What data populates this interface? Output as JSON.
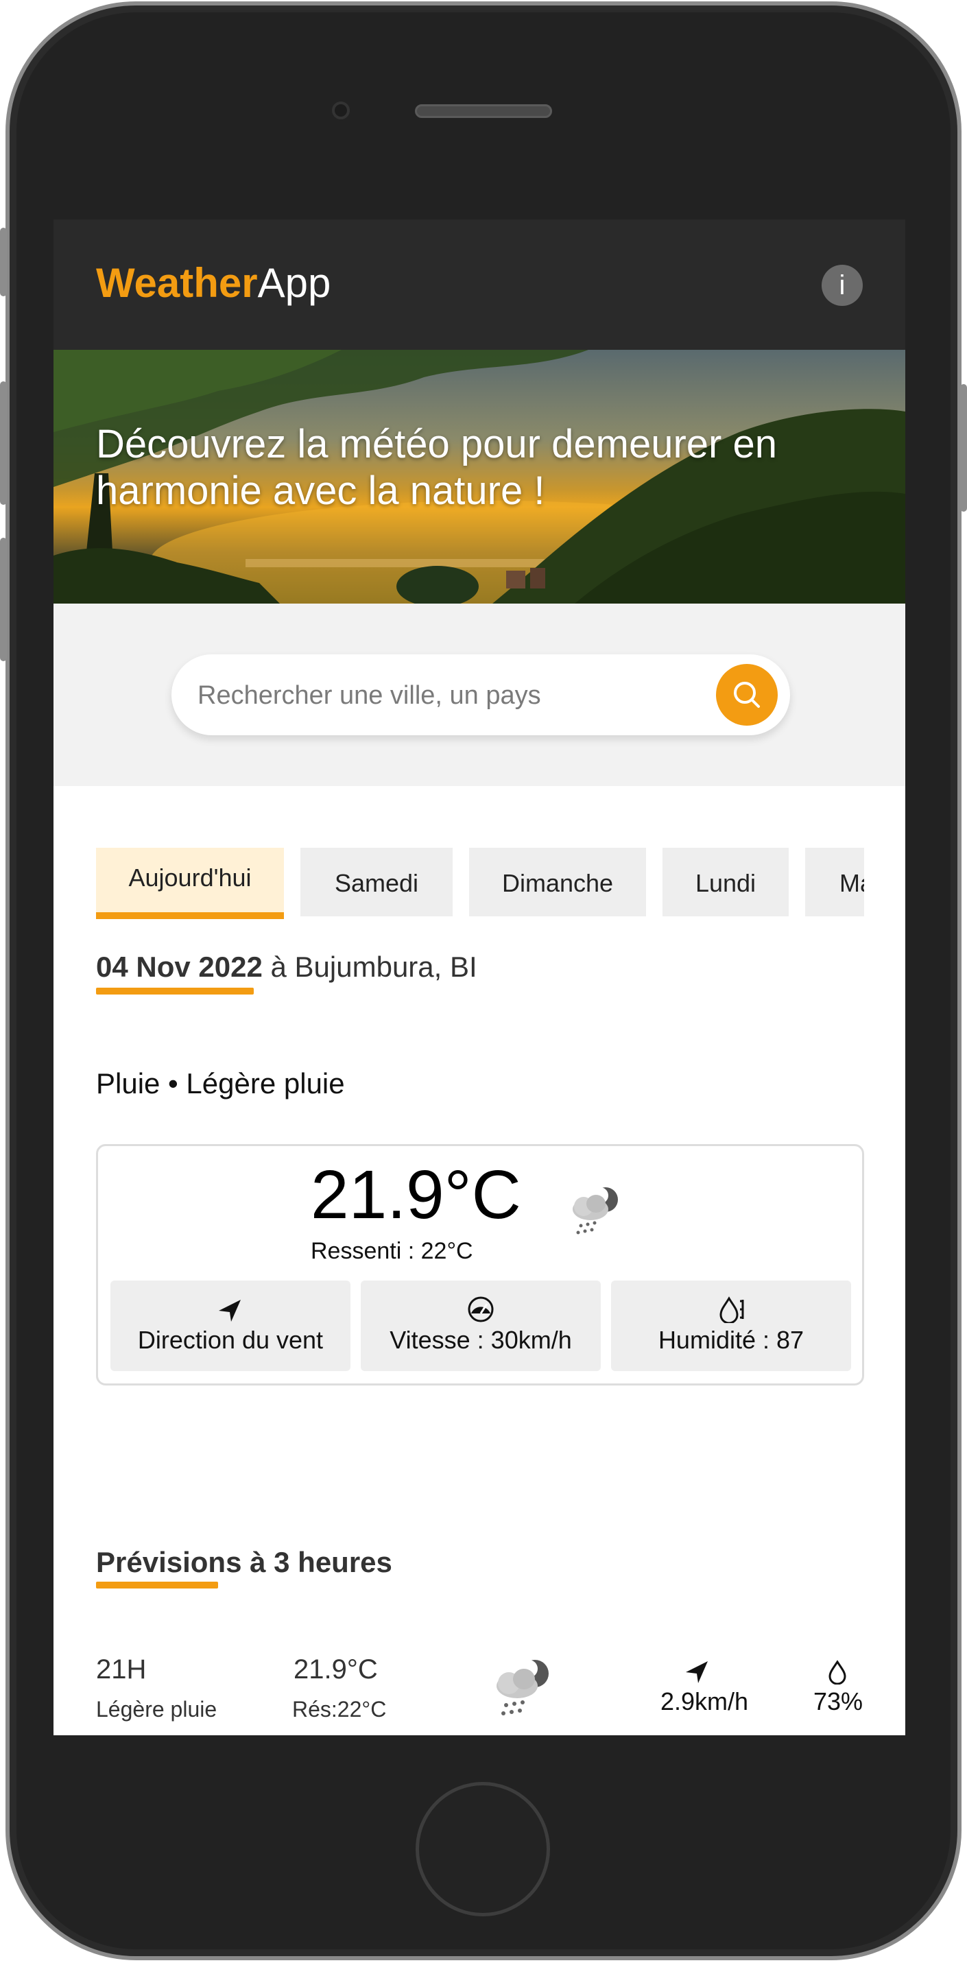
{
  "app": {
    "title_part1": "Weather",
    "title_part2": "App",
    "info_label": "i"
  },
  "hero": {
    "title": "Découvrez la météo pour demeurer en harmonie avec la nature !"
  },
  "search": {
    "placeholder": "Rechercher une ville, un pays"
  },
  "tabs": [
    {
      "label": "Aujourd'hui",
      "active": true
    },
    {
      "label": "Samedi",
      "active": false
    },
    {
      "label": "Dimanche",
      "active": false
    },
    {
      "label": "Lundi",
      "active": false
    },
    {
      "label": "Ma",
      "active": false
    }
  ],
  "current": {
    "date": "04 Nov 2022",
    "location": " à Bujumbura, BI",
    "condition": "Pluie • Légère pluie",
    "temperature": "21.9°C",
    "felt": "Ressenti : 22°C",
    "weather_icon": "rain-cloud-moon-icon",
    "stats": {
      "wind_direction": "Direction du vent",
      "wind_speed": "Vitesse : 30km/h",
      "humidity": "Humidité : 87"
    }
  },
  "forecast": {
    "title": "Prévisions à 3 heures",
    "items": [
      {
        "hour": "21H",
        "description": "Légère pluie",
        "temperature": "21.9°C",
        "felt": "Rés:22°C",
        "wind": "2.9km/h",
        "humidity": "73%",
        "icon": "rain-cloud-moon-icon"
      }
    ]
  },
  "colors": {
    "accent": "#f39c12",
    "header_bg": "#2a2a2a",
    "tab_bg": "#eeeeee",
    "tab_active_bg": "#fff1d6"
  }
}
